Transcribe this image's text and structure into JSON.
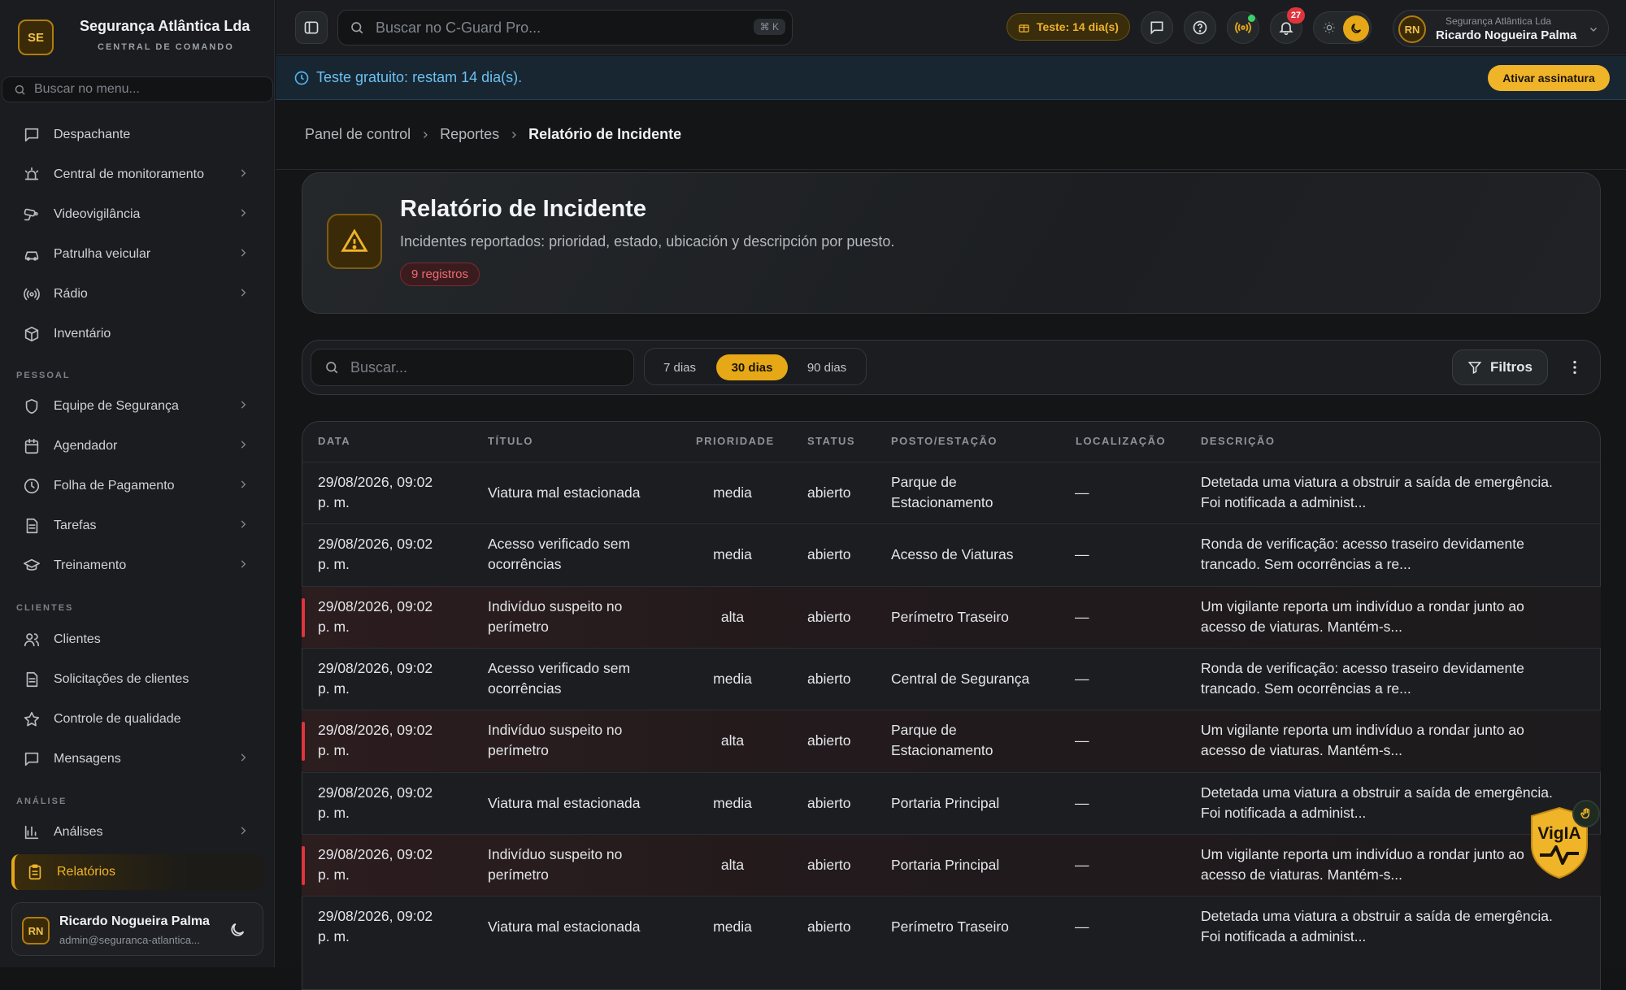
{
  "brand": {
    "initials": "SE",
    "name": "Segurança Atlântica Lda",
    "subtitle": "CENTRAL DE COMANDO"
  },
  "menu_search": {
    "placeholder": "Buscar no menu..."
  },
  "sidebar": {
    "items_top": [
      {
        "label": "Despachante",
        "icon": "message-square-icon",
        "chevron": false
      },
      {
        "label": "Central de monitoramento",
        "icon": "siren-icon",
        "chevron": true
      },
      {
        "label": "Videovigilância",
        "icon": "cctv-icon",
        "chevron": true
      },
      {
        "label": "Patrulha veicular",
        "icon": "car-icon",
        "chevron": true
      },
      {
        "label": "Rádio",
        "icon": "radio-icon",
        "chevron": true
      },
      {
        "label": "Inventário",
        "icon": "package-icon",
        "chevron": false
      }
    ],
    "section_pessoal": "PESSOAL",
    "items_pessoal": [
      {
        "label": "Equipe de Segurança",
        "icon": "shield-icon",
        "chevron": true
      },
      {
        "label": "Agendador",
        "icon": "calendar-icon",
        "chevron": true
      },
      {
        "label": "Folha de Pagamento",
        "icon": "clock-icon",
        "chevron": true
      },
      {
        "label": "Tarefas",
        "icon": "file-text-icon",
        "chevron": true
      },
      {
        "label": "Treinamento",
        "icon": "graduation-cap-icon",
        "chevron": true
      }
    ],
    "section_clientes": "CLIENTES",
    "items_clientes": [
      {
        "label": "Clientes",
        "icon": "users-icon",
        "chevron": false
      },
      {
        "label": "Solicitações de clientes",
        "icon": "file-text-icon",
        "chevron": false
      },
      {
        "label": "Controle de qualidade",
        "icon": "star-icon",
        "chevron": false
      },
      {
        "label": "Mensagens",
        "icon": "message-square-icon",
        "chevron": true
      }
    ],
    "section_analise": "ANÁLISE",
    "items_analise": [
      {
        "label": "Análises",
        "icon": "bar-chart-icon",
        "chevron": true
      },
      {
        "label": "Relatórios",
        "icon": "clipboard-icon",
        "chevron": false,
        "active": true
      }
    ]
  },
  "user": {
    "initials": "RN",
    "name": "Ricardo Nogueira Palma",
    "email": "admin@seguranca-atlantica..."
  },
  "topbar": {
    "search_placeholder": "Buscar no C-Guard Pro...",
    "shortcut": "⌘ K",
    "trial_badge": "Teste: 14 dia(s)",
    "notifications_count": "27",
    "account_company": "Segurança Atlântica Lda",
    "account_name": "Ricardo Nogueira Palma",
    "account_initials": "RN"
  },
  "banner": {
    "text": "Teste gratuito: restam 14 dia(s).",
    "button": "Ativar assinatura"
  },
  "breadcrumb": [
    "Panel de control",
    "Reportes",
    "Relatório de Incidente"
  ],
  "header": {
    "title": "Relatório de Incidente",
    "subtitle": "Incidentes reportados: prioridad, estado, ubicación y descripción por puesto.",
    "badge": "9 registros"
  },
  "toolbar": {
    "search_placeholder": "Buscar...",
    "ranges": [
      "7 dias",
      "30 dias",
      "90 dias"
    ],
    "selected_range": "30 dias",
    "filters": "Filtros"
  },
  "table": {
    "columns": [
      "DATA",
      "TÍTULO",
      "PRIORIDADE",
      "STATUS",
      "POSTO/ESTAÇÃO",
      "LOCALIZAÇÃO",
      "DESCRIÇÃO"
    ],
    "rows": [
      {
        "date1": "29/08/2026, 09:02",
        "date2": "p. m.",
        "title1": "Viatura mal estacionada",
        "title2": "",
        "priority": "media",
        "status": "abierto",
        "post1": "Parque de",
        "post2": "Estacionamento",
        "location": "—",
        "desc1": "Detetada uma viatura a obstruir a saída de emergência.",
        "desc2": "Foi notificada a administ..."
      },
      {
        "date1": "29/08/2026, 09:02",
        "date2": "p. m.",
        "title1": "Acesso verificado sem",
        "title2": "ocorrências",
        "priority": "media",
        "status": "abierto",
        "post1": "Acesso de Viaturas",
        "post2": "",
        "location": "—",
        "desc1": "Ronda de verificação: acesso traseiro devidamente",
        "desc2": "trancado. Sem ocorrências a re..."
      },
      {
        "date1": "29/08/2026, 09:02",
        "date2": "p. m.",
        "title1": "Indivíduo suspeito no",
        "title2": "perímetro",
        "priority": "alta",
        "status": "abierto",
        "post1": "Perímetro Traseiro",
        "post2": "",
        "location": "—",
        "desc1": "Um vigilante reporta um indivíduo a rondar junto ao",
        "desc2": "acesso de viaturas. Mantém-s..."
      },
      {
        "date1": "29/08/2026, 09:02",
        "date2": "p. m.",
        "title1": "Acesso verificado sem",
        "title2": "ocorrências",
        "priority": "media",
        "status": "abierto",
        "post1": "Central de Segurança",
        "post2": "",
        "location": "—",
        "desc1": "Ronda de verificação: acesso traseiro devidamente",
        "desc2": "trancado. Sem ocorrências a re..."
      },
      {
        "date1": "29/08/2026, 09:02",
        "date2": "p. m.",
        "title1": "Indivíduo suspeito no",
        "title2": "perímetro",
        "priority": "alta",
        "status": "abierto",
        "post1": "Parque de",
        "post2": "Estacionamento",
        "location": "—",
        "desc1": "Um vigilante reporta um indivíduo a rondar junto ao",
        "desc2": "acesso de viaturas. Mantém-s..."
      },
      {
        "date1": "29/08/2026, 09:02",
        "date2": "p. m.",
        "title1": "Viatura mal estacionada",
        "title2": "",
        "priority": "media",
        "status": "abierto",
        "post1": "Portaria Principal",
        "post2": "",
        "location": "—",
        "desc1": "Detetada uma viatura a obstruir a saída de emergência.",
        "desc2": "Foi notificada a administ..."
      },
      {
        "date1": "29/08/2026, 09:02",
        "date2": "p. m.",
        "title1": "Indivíduo suspeito no",
        "title2": "perímetro",
        "priority": "alta",
        "status": "abierto",
        "post1": "Portaria Principal",
        "post2": "",
        "location": "—",
        "desc1": "Um vigilante reporta um indivíduo a rondar junto ao",
        "desc2": "acesso de viaturas. Mantém-s..."
      },
      {
        "date1": "29/08/2026, 09:02",
        "date2": "p. m.",
        "title1": "Viatura mal estacionada",
        "title2": "",
        "priority": "media",
        "status": "abierto",
        "post1": "Perímetro Traseiro",
        "post2": "",
        "location": "—",
        "desc1": "Detetada uma viatura a obstruir a saída de emergência.",
        "desc2": "Foi notificada a administ..."
      }
    ]
  },
  "assistant": {
    "label": "VigIA"
  },
  "colors": {
    "accent": "#e6a817",
    "danger": "#e0343d",
    "info": "#4fb3f2"
  }
}
